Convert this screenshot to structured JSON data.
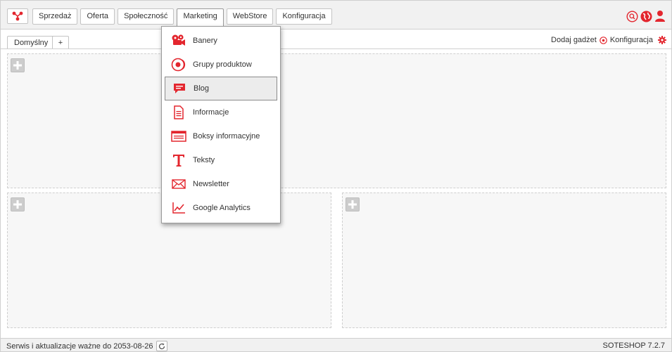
{
  "nav": {
    "items": [
      {
        "label": "Sprzedaż"
      },
      {
        "label": "Oferta"
      },
      {
        "label": "Społeczność"
      },
      {
        "label": "Marketing"
      },
      {
        "label": "WebStore"
      },
      {
        "label": "Konfiguracja"
      }
    ],
    "active": "Marketing"
  },
  "tabs": {
    "default_label": "Domyślny",
    "add_label": "+"
  },
  "actions": {
    "add_gadget": "Dodaj gadżet",
    "config": "Konfiguracja"
  },
  "marketing_menu": {
    "items": [
      {
        "label": "Banery",
        "icon": "banner-icon"
      },
      {
        "label": "Grupy produktow",
        "icon": "product-groups-icon"
      },
      {
        "label": "Blog",
        "icon": "blog-icon"
      },
      {
        "label": "Informacje",
        "icon": "document-icon"
      },
      {
        "label": "Boksy informacyjne",
        "icon": "info-box-icon"
      },
      {
        "label": "Teksty",
        "icon": "text-icon"
      },
      {
        "label": "Newsletter",
        "icon": "envelope-icon"
      },
      {
        "label": "Google Analytics",
        "icon": "chart-line-icon"
      }
    ],
    "selected": "Blog"
  },
  "status": {
    "left": "Serwis i aktualizacje ważne do 2053-08-26",
    "right": "SOTESHOP 7.2.7"
  },
  "colors": {
    "accent": "#e3262e",
    "background": "#f1f1f1"
  }
}
